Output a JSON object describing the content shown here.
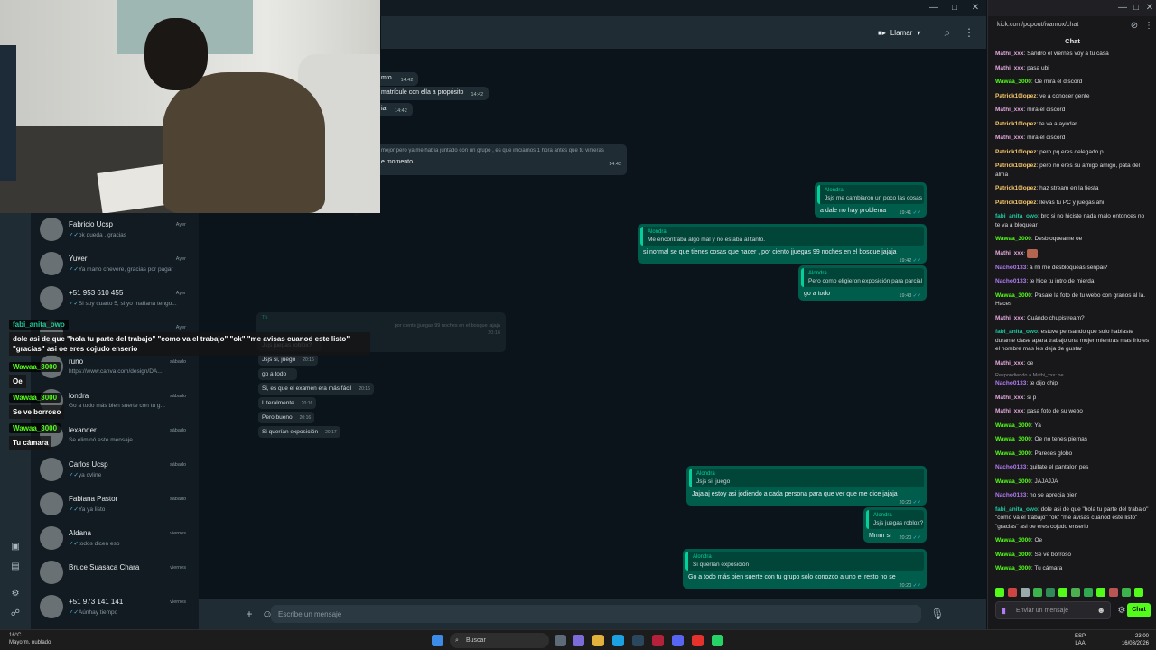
{
  "whatsapp": {
    "header": {
      "call_label": "Llamar"
    },
    "chats": [
      {
        "name": "Fabricio Ucsp",
        "last": "ok queda , gracias",
        "time": "Ayer",
        "ticks": "✓✓"
      },
      {
        "name": "Yuver",
        "last": "Ya mano chevere, gracias por pagar",
        "time": "Ayer",
        "ticks": "✓✓"
      },
      {
        "name": "+51 953 610 455",
        "last": "Si soy cuarto 5, si yo mañana tengo...",
        "time": "Ayer",
        "ticks": "✓✓"
      },
      {
        "name": "",
        "last": "",
        "time": "Ayer",
        "ticks": ""
      },
      {
        "name": "runo",
        "last": "https://www.canva.com/design/DA...",
        "time": "sábado",
        "ticks": ""
      },
      {
        "name": "londra",
        "last": "Go a todo más bien suerte con tu g...",
        "time": "sábado",
        "ticks": ""
      },
      {
        "name": "lexander",
        "last": "Se eliminó este mensaje.",
        "time": "sábado",
        "ticks": ""
      },
      {
        "name": "Carlos Ucsp",
        "last": "ya cvline",
        "time": "sábado",
        "ticks": "✓✓"
      },
      {
        "name": "Fabiana Pastor",
        "last": "Ya ya listo",
        "time": "sábado",
        "ticks": "✓✓"
      },
      {
        "name": "Aldana",
        "last": "todos dicen eso",
        "time": "viernes",
        "ticks": "✓✓"
      },
      {
        "name": "Bruce Suasaca Chara",
        "last": "",
        "time": "viernes",
        "ticks": ""
      },
      {
        "name": "+51 973 141 141",
        "last": "Aúnhay tiempo",
        "time": "viernes",
        "ticks": "✓✓"
      }
    ],
    "incoming": [
      {
        "text": "mto.",
        "time": "14:42"
      },
      {
        "text": "matrícule con ella a propósito",
        "time": "14:42"
      },
      {
        "text": "ial",
        "time": "14:42"
      },
      {
        "text": "mejor pero ya me había juntado con un grupo , es que iniciamos 1 hora antes que tú vinieras",
        "time": ""
      },
      {
        "text": "e momento",
        "time": "14:42"
      }
    ],
    "outgoing": [
      {
        "quote_author": "Alondra",
        "quote": "Jsjs me cambiaron un poco las cosas",
        "text": "a dale no hay problema",
        "time": "19:41"
      },
      {
        "quote_author": "Alondra",
        "quote": "Me encontraba algo mal y no estaba al tanto.",
        "text": "si normal se que tienes cosas que hacer , por ciento jjuegas 99 noches en el bosque jajaja",
        "time": "19:42"
      },
      {
        "quote_author": "Alondra",
        "quote": "Pero como eligieron exposición para parcial",
        "text": "go a todo",
        "time": "19:43"
      },
      {
        "quote_author": "Alondra",
        "quote": "Jsjs si, juego",
        "text": "Jajajaj estoy asi jodiendo a cada persona para que ver que me dice jajaja",
        "time": "20:20"
      },
      {
        "quote_author": "Alondra",
        "quote": "Jsjs juegas roblox?",
        "text": "Mmm si",
        "time": "20:20"
      },
      {
        "quote_author": "Alondra",
        "quote": "Si querían exposición",
        "text": "Go a todo más bien suerte con tu grupo solo conozco a uno el resto no se",
        "time": "20:20"
      }
    ],
    "faded": {
      "tu_label": "Tú",
      "tu_quote": "por ciento jjuegas 99 noches en el bosque jajaja",
      "tu_time": "20:16",
      "lines": [
        {
          "text": "Jsjs juegas roblox?",
          "time": ""
        },
        {
          "text": "Jsjs si, juego",
          "time": "20:16"
        },
        {
          "text": "go a todo",
          "time": ""
        },
        {
          "text": "Si, es que el examen era más fácil",
          "time": "20:16"
        },
        {
          "text": "Literalmente",
          "time": "20:16"
        },
        {
          "text": "Pero bueno",
          "time": "20:16"
        },
        {
          "text": "Si querían exposición",
          "time": "20:17"
        }
      ]
    },
    "composer_placeholder": "Escribe un mensaje"
  },
  "overlay": [
    {
      "user": "fabi_anita_owo",
      "text": "dole asi de que \"hola tu parte del trabajo\" \"como va el trabajo\" \"ok\" \"me avisas cuanod este listo\" \"gracias\" asi oe eres cojudo enserio",
      "color": "#20c9a0"
    },
    {
      "user": "Wawaa_3000",
      "text": "Oe",
      "color": "#53fc18"
    },
    {
      "user": "Wawaa_3000",
      "text": "Se ve borroso",
      "color": "#53fc18"
    },
    {
      "user": "Wawaa_3000",
      "text": "Tu cámara",
      "color": "#53fc18"
    }
  ],
  "kick": {
    "url": "kick.com/popout/ivanrox/chat",
    "title": "Chat",
    "reply_note": "Respondiendo a Mathi_xxx: oe",
    "messages": [
      {
        "user": "Mathi_xxx",
        "text": "Sandro el viernes voy a tu casa",
        "color": "#e0a6d8"
      },
      {
        "user": "Mathi_xxx",
        "text": "pasa ubi",
        "color": "#e0a6d8"
      },
      {
        "user": "Wawaa_3000",
        "text": "Oe mira el discord",
        "color": "#53fc18"
      },
      {
        "user": "Patrick10lopez",
        "text": "ve a conocer gente",
        "color": "#f7c86a"
      },
      {
        "user": "Mathi_xxx",
        "text": "mira el discord",
        "color": "#e0a6d8"
      },
      {
        "user": "Patrick10lopez",
        "text": "te va a ayudar",
        "color": "#f7c86a"
      },
      {
        "user": "Mathi_xxx",
        "text": "mira el discord",
        "color": "#e0a6d8"
      },
      {
        "user": "Patrick10lopez",
        "text": "pero pq eres delegado p",
        "color": "#f7c86a"
      },
      {
        "user": "Patrick10lopez",
        "text": "pero no eres su amigo amigo, pata del alma",
        "color": "#f7c86a"
      },
      {
        "user": "Patrick10lopez",
        "text": "haz stream en la fiesta",
        "color": "#f7c86a"
      },
      {
        "user": "Patrick10lopez",
        "text": "llevas tu PC y juegas ahi",
        "color": "#f7c86a"
      },
      {
        "user": "fabi_anita_owo",
        "text": "bro si no hiciste nada malo entonces no te va a bloquear",
        "color": "#20c9a0"
      },
      {
        "user": "Wawaa_3000",
        "text": "Desbloqueame oe",
        "color": "#53fc18"
      },
      {
        "user": "Mathi_xxx",
        "text": "",
        "color": "#e0a6d8",
        "emote": true
      },
      {
        "user": "Nacho0133",
        "text": "a mi me desbloqueas senpai?",
        "color": "#b07cf2"
      },
      {
        "user": "Nacho0133",
        "text": "te hice tu intro de mierda",
        "color": "#b07cf2"
      },
      {
        "user": "Wawaa_3000",
        "text": "Pasale la foto de tu webo con granos al la. Haces",
        "color": "#53fc18"
      },
      {
        "user": "Mathi_xxx",
        "text": "Cuándo chupistream?",
        "color": "#e0a6d8"
      },
      {
        "user": "fabi_anita_owo",
        "text": "estuve pensando que solo hablaste durante clase apara trabajo una mujer mientras mas frio es el hombre mas les deja de gustar",
        "color": "#20c9a0"
      },
      {
        "user": "Mathi_xxx",
        "text": "oe",
        "color": "#e0a6d8"
      },
      {
        "user": "Nacho0133",
        "text": "te dijo chipi",
        "color": "#b07cf2",
        "reply": true
      },
      {
        "user": "Mathi_xxx",
        "text": "si p",
        "color": "#e0a6d8"
      },
      {
        "user": "Mathi_xxx",
        "text": "pasa foto de su webo",
        "color": "#e0a6d8"
      },
      {
        "user": "Wawaa_3000",
        "text": "Ya",
        "color": "#53fc18"
      },
      {
        "user": "Wawaa_3000",
        "text": "Oe no tenes piernas",
        "color": "#53fc18"
      },
      {
        "user": "Wawaa_3000",
        "text": "Pareces globo",
        "color": "#53fc18"
      },
      {
        "user": "Nacho0133",
        "text": "quitate el pantalon pes",
        "color": "#b07cf2"
      },
      {
        "user": "Wawaa_3000",
        "text": "JAJAJJA",
        "color": "#53fc18"
      },
      {
        "user": "Nacho0133",
        "text": "no se aprecia bien",
        "color": "#b07cf2"
      },
      {
        "user": "fabi_anita_owo",
        "text": "dole asi de que \"hola tu parte del trabajo\" \"como va el trabajo\" \"ok\" \"me avisas cuanod este listo\" \"gracias\" asi oe eres cojudo enserio",
        "color": "#20c9a0"
      },
      {
        "user": "Wawaa_3000",
        "text": "Oe",
        "color": "#53fc18"
      },
      {
        "user": "Wawaa_3000",
        "text": "Se ve borroso",
        "color": "#53fc18"
      },
      {
        "user": "Wawaa_3000",
        "text": "Tu cámara",
        "color": "#53fc18"
      }
    ],
    "input_placeholder": "Enviar un mensaje",
    "chat_button": "Chat"
  },
  "taskbar": {
    "temp": "16°C",
    "weather": "Mayorm. nublado",
    "search": "Buscar",
    "lang1": "ESP",
    "lang2": "LAA",
    "time": "23:00",
    "date": "16/03/2026"
  }
}
